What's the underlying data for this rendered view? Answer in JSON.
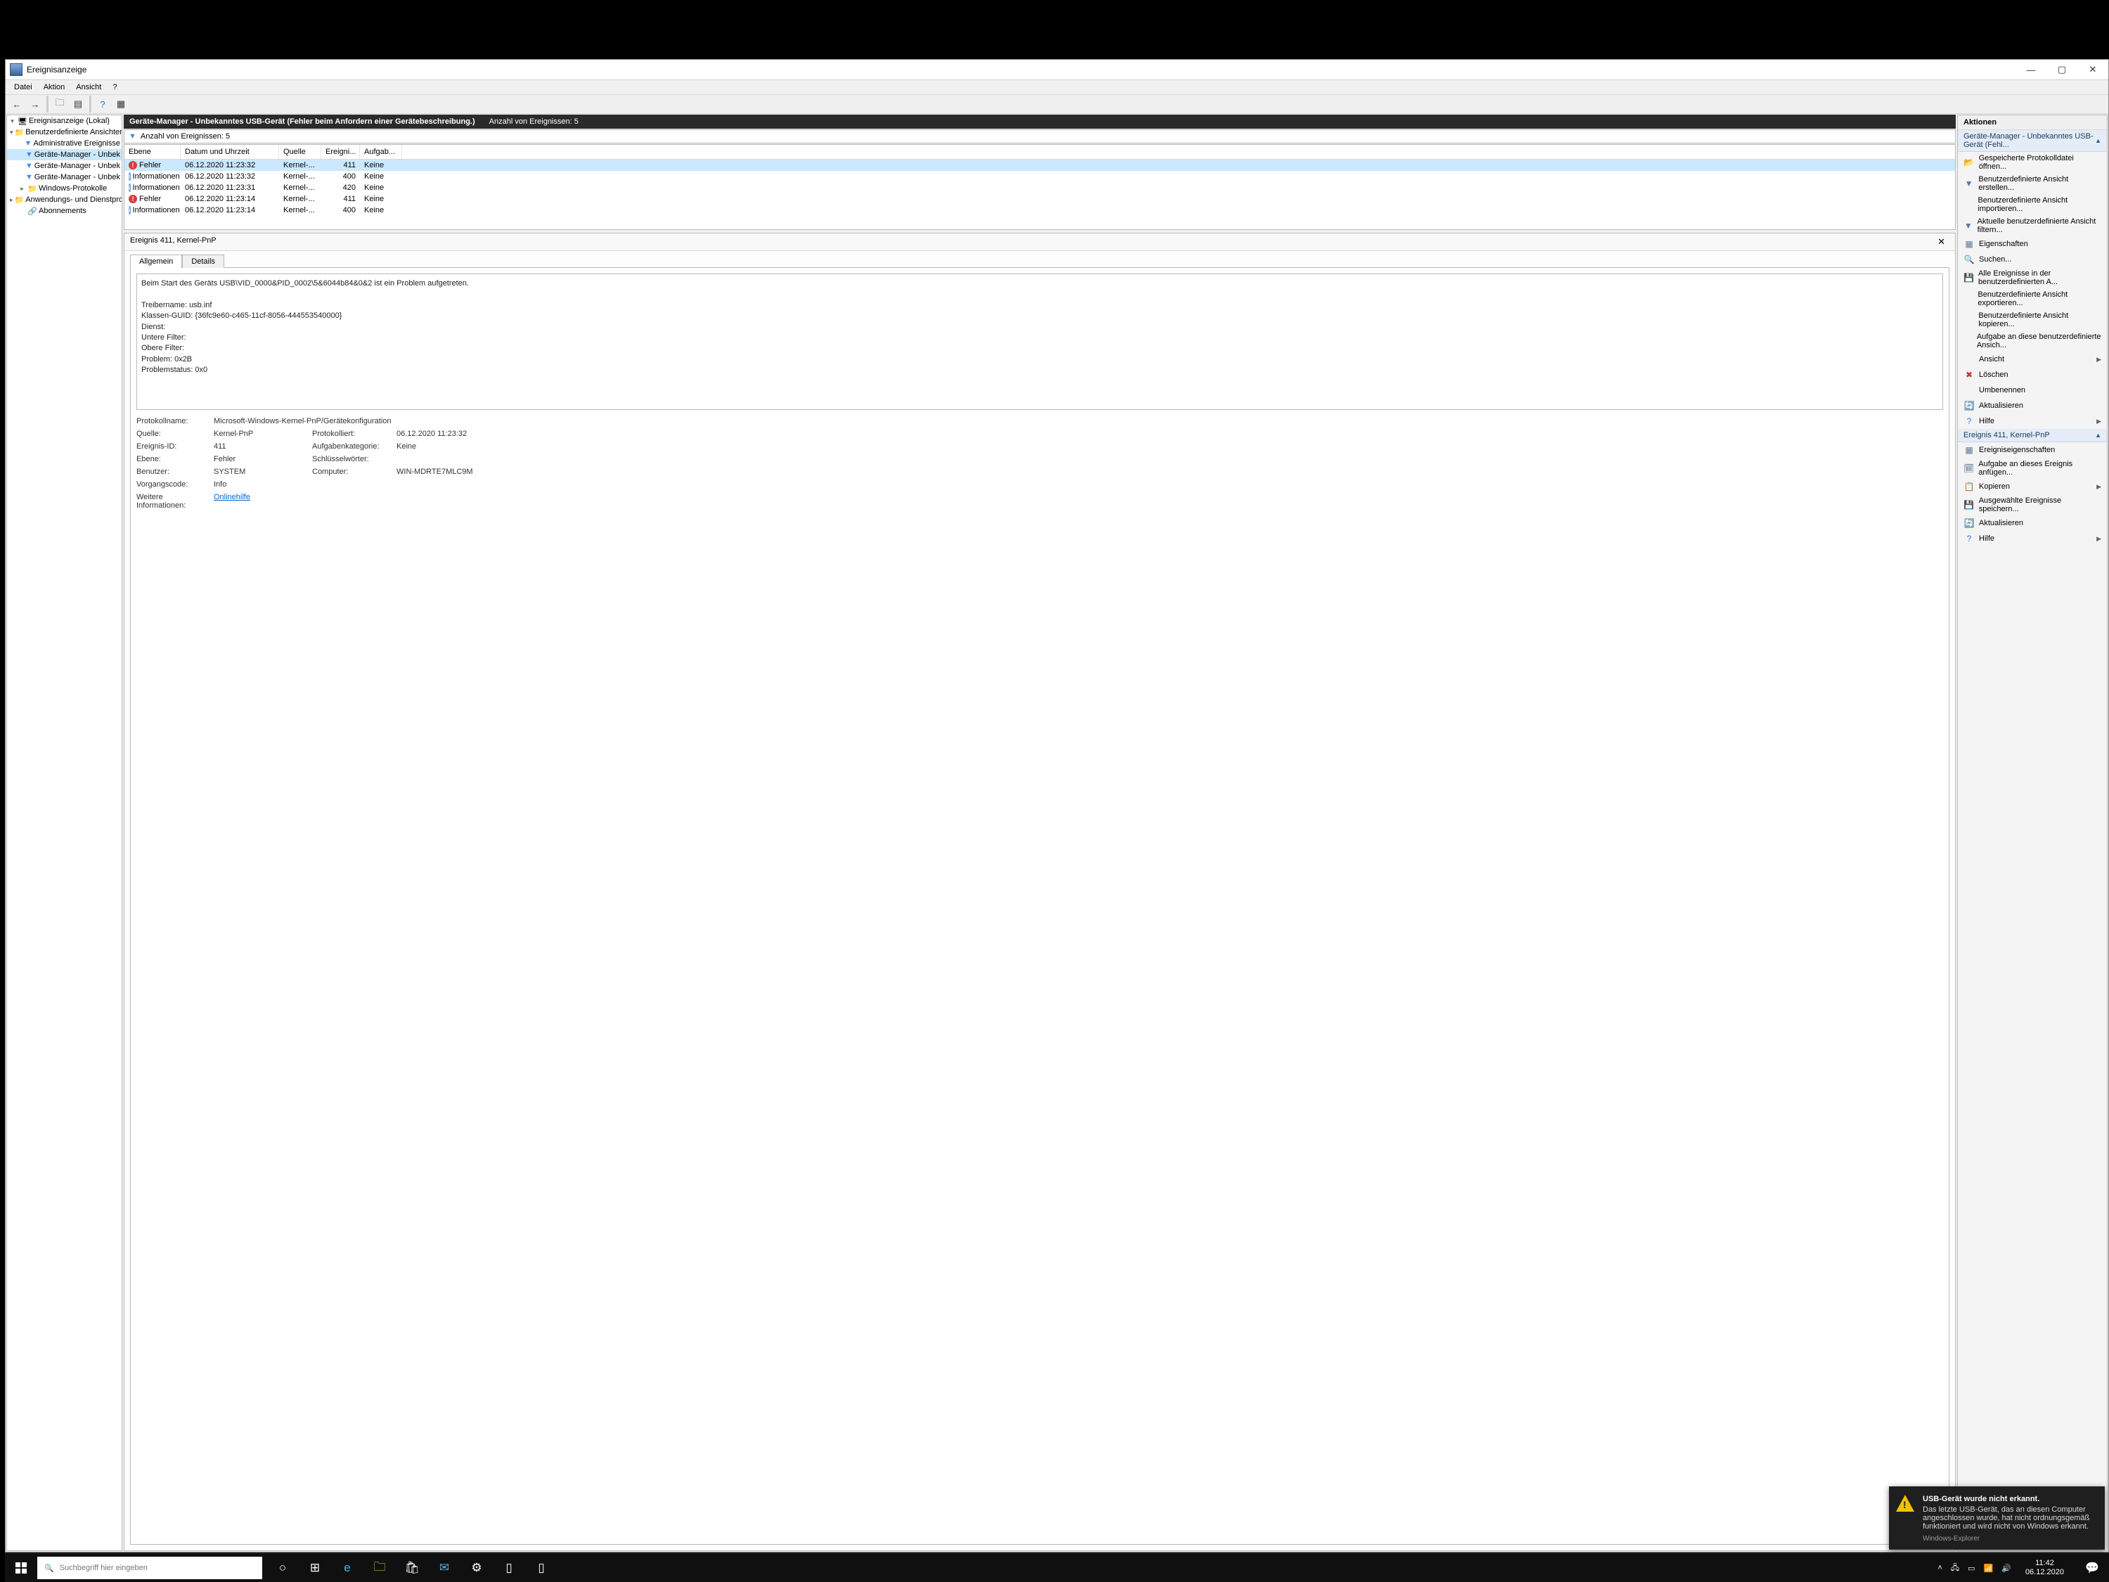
{
  "window": {
    "title": "Ereignisanzeige",
    "menu": [
      "Datei",
      "Aktion",
      "Ansicht",
      "?"
    ]
  },
  "tree": {
    "root": "Ereignisanzeige (Lokal)",
    "items": [
      {
        "label": "Benutzerdefinierte Ansichten",
        "indent": 1,
        "expand": "▾",
        "icon": "📁"
      },
      {
        "label": "Administrative Ereignisse",
        "indent": 2,
        "icon": "▼"
      },
      {
        "label": "Geräte-Manager - Unbek",
        "indent": 2,
        "icon": "▼",
        "selected": true
      },
      {
        "label": "Geräte-Manager - Unbek",
        "indent": 2,
        "icon": "▼"
      },
      {
        "label": "Geräte-Manager - Unbek",
        "indent": 2,
        "icon": "▼"
      },
      {
        "label": "Windows-Protokolle",
        "indent": 1,
        "expand": "▸",
        "icon": "📁"
      },
      {
        "label": "Anwendungs- und Dienstpro",
        "indent": 1,
        "expand": "▸",
        "icon": "📁"
      },
      {
        "label": "Abonnements",
        "indent": 1,
        "icon": "🔗"
      }
    ]
  },
  "center": {
    "header_title": "Geräte-Manager - Unbekanntes USB-Gerät (Fehler beim Anfordern einer Gerätebeschreibung.)",
    "header_count": "Anzahl von Ereignissen: 5",
    "filter_label": "Anzahl von Ereignissen: 5",
    "columns": [
      "Ebene",
      "Datum und Uhrzeit",
      "Quelle",
      "Ereigni...",
      "Aufgab..."
    ],
    "rows": [
      {
        "level": "Fehler",
        "icon": "err",
        "dt": "06.12.2020 11:23:32",
        "src": "Kernel-...",
        "id": "411",
        "task": "Keine",
        "selected": true
      },
      {
        "level": "Informationen",
        "icon": "info",
        "dt": "06.12.2020 11:23:32",
        "src": "Kernel-...",
        "id": "400",
        "task": "Keine"
      },
      {
        "level": "Informationen",
        "icon": "info",
        "dt": "06.12.2020 11:23:31",
        "src": "Kernel-...",
        "id": "420",
        "task": "Keine"
      },
      {
        "level": "Fehler",
        "icon": "err",
        "dt": "06.12.2020 11:23:14",
        "src": "Kernel-...",
        "id": "411",
        "task": "Keine"
      },
      {
        "level": "Informationen",
        "icon": "info",
        "dt": "06.12.2020 11:23:14",
        "src": "Kernel-...",
        "id": "400",
        "task": "Keine"
      }
    ]
  },
  "detail": {
    "header": "Ereignis 411, Kernel-PnP",
    "tabs": [
      "Allgemein",
      "Details"
    ],
    "message": "Beim Start des Geräts USB\\VID_0000&PID_0002\\5&6044b84&0&2 ist ein Problem aufgetreten.\n\nTreibername: usb.inf\nKlassen-GUID: {36fc9e60-c465-11cf-8056-444553540000}\nDienst:\nUntere Filter:\nObere Filter:\nProblem: 0x2B\nProblemstatus: 0x0",
    "props": {
      "Protokollname": "Microsoft-Windows-Kernel-PnP/Gerätekonfiguration",
      "Quelle": "Kernel-PnP",
      "Protokolliert": "06.12.2020 11:23:32",
      "Ereignis-ID": "411",
      "Aufgabenkategorie": "Keine",
      "Ebene": "Fehler",
      "Schlüsselwörter": "",
      "Benutzer": "SYSTEM",
      "Computer": "WIN-MDRTE7MLC9M",
      "Vorgangscode": "Info",
      "Weitere_Info_lbl": "Weitere Informationen:",
      "Weitere_Info_link": "Onlinehilfe"
    }
  },
  "actions": {
    "title": "Aktionen",
    "group1_title": "Geräte-Manager - Unbekanntes USB-Gerät (Fehl...",
    "group1": [
      {
        "icon": "📂",
        "label": "Gespeicherte Protokolldatei öffnen..."
      },
      {
        "icon": "▼",
        "label": "Benutzerdefinierte Ansicht erstellen..."
      },
      {
        "icon": "",
        "label": "Benutzerdefinierte Ansicht importieren..."
      },
      {
        "icon": "▼",
        "label": "Aktuelle benutzerdefinierte Ansicht filtern..."
      },
      {
        "icon": "▦",
        "label": "Eigenschaften"
      },
      {
        "icon": "🔍",
        "label": "Suchen..."
      },
      {
        "icon": "💾",
        "label": "Alle Ereignisse in der benutzerdefinierten A..."
      },
      {
        "icon": "",
        "label": "Benutzerdefinierte Ansicht exportieren..."
      },
      {
        "icon": "",
        "label": "Benutzerdefinierte Ansicht kopieren..."
      },
      {
        "icon": "",
        "label": "Aufgabe an diese benutzerdefinierte Ansich..."
      },
      {
        "icon": "",
        "label": "Ansicht",
        "arrow": true
      },
      {
        "icon": "✖",
        "label": "Löschen",
        "iconColor": "#c0392b"
      },
      {
        "icon": "",
        "label": "Umbenennen"
      },
      {
        "icon": "🔄",
        "label": "Aktualisieren"
      },
      {
        "icon": "?",
        "label": "Hilfe",
        "arrow": true,
        "iconColor": "#2e7cd6"
      }
    ],
    "group2_title": "Ereignis 411, Kernel-PnP",
    "group2": [
      {
        "icon": "▦",
        "label": "Ereigniseigenschaften"
      },
      {
        "icon": "🗓",
        "label": "Aufgabe an dieses Ereignis anfügen..."
      },
      {
        "icon": "📋",
        "label": "Kopieren",
        "arrow": true
      },
      {
        "icon": "💾",
        "label": "Ausgewählte Ereignisse speichern..."
      },
      {
        "icon": "🔄",
        "label": "Aktualisieren"
      },
      {
        "icon": "?",
        "label": "Hilfe",
        "arrow": true,
        "iconColor": "#2e7cd6"
      }
    ]
  },
  "toast": {
    "title": "USB-Gerät wurde nicht erkannt.",
    "body": "Das letzte USB-Gerät, das an diesen Computer angeschlossen wurde, hat nicht ordnungsgemäß funktioniert und wird nicht von Windows erkannt.",
    "source": "Windows-Explorer"
  },
  "taskbar": {
    "search_placeholder": "Suchbegriff hier eingeben",
    "time": "11:42",
    "date": "06.12.2020"
  }
}
